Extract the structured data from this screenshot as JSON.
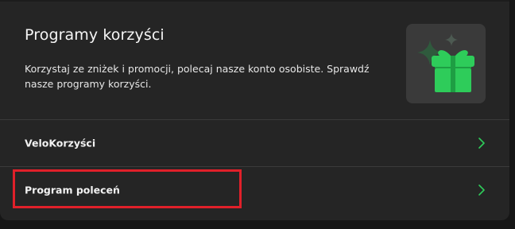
{
  "card": {
    "title": "Programy korzyści",
    "description": "Korzystaj ze zniżek i promocji, polecaj nasze konto osobiste. Sprawdź nasze programy korzyści.",
    "illustration_icon": "gift-icon"
  },
  "rows": [
    {
      "label": "VeloKorzyści",
      "icon": "chevron-right-icon"
    },
    {
      "label": "Program poleceń",
      "icon": "chevron-right-icon"
    }
  ],
  "colors": {
    "accent": "#2ecc5a",
    "highlight": "#e0202a",
    "card_bg": "#252525"
  }
}
